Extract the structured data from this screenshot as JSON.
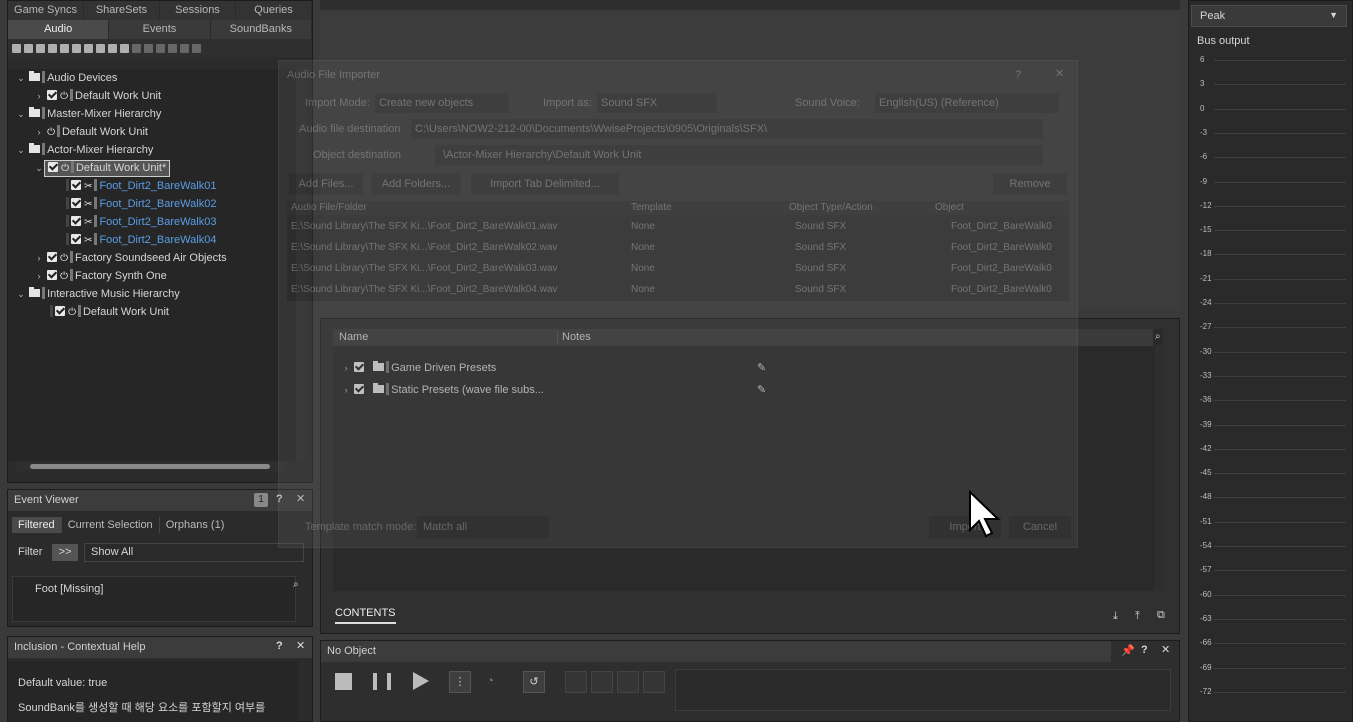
{
  "project_explorer": {
    "top_tabs": [
      "Game Syncs",
      "ShareSets",
      "Sessions",
      "Queries"
    ],
    "main_tabs": [
      "Audio",
      "Events",
      "SoundBanks"
    ],
    "tree": [
      {
        "label": "Audio Devices",
        "kind": "folder"
      },
      {
        "label": "Default Work Unit",
        "kind": "wu"
      },
      {
        "label": "Master-Mixer Hierarchy",
        "kind": "folder"
      },
      {
        "label": "Default Work Unit",
        "kind": "wu"
      },
      {
        "label": "Actor-Mixer Hierarchy",
        "kind": "folder"
      },
      {
        "label": "Default Work Unit*",
        "kind": "wu-selected"
      },
      {
        "label": "Foot_Dirt2_BareWalk01",
        "kind": "sfx"
      },
      {
        "label": "Foot_Dirt2_BareWalk02",
        "kind": "sfx"
      },
      {
        "label": "Foot_Dirt2_BareWalk03",
        "kind": "sfx"
      },
      {
        "label": "Foot_Dirt2_BareWalk04",
        "kind": "sfx"
      },
      {
        "label": "Factory Soundseed Air Objects",
        "kind": "wu"
      },
      {
        "label": "Factory Synth One",
        "kind": "wu"
      },
      {
        "label": "Interactive Music Hierarchy",
        "kind": "folder"
      },
      {
        "label": "Default Work Unit",
        "kind": "wu"
      }
    ]
  },
  "event_viewer": {
    "title": "Event Viewer",
    "badge": "1",
    "tabs": [
      "Filtered",
      "Current Selection",
      "Orphans (1)"
    ],
    "filter_label": "Filter",
    "filter_btn": ">>",
    "filter_value": "Show All",
    "result": "Foot [Missing]"
  },
  "inclusion_help": {
    "title": "Inclusion - Contextual Help",
    "line1": "Default value: true",
    "line2": "SoundBank를 생성할 때 해당 요소를 포함할지 여부를"
  },
  "importer": {
    "title": "Audio File Importer",
    "import_mode_label": "Import Mode:",
    "import_mode_value": "Create new objects",
    "import_as_label": "Import as:",
    "import_as_value": "Sound SFX",
    "voice_label": "Sound Voice:",
    "voice_value": "English(US) (Reference)",
    "dest_label": "Audio file destination",
    "dest_value": "C:\\Users\\NOW2-212-00\\Documents\\WwiseProjects\\0905\\Originals\\SFX\\",
    "obj_dest_label": "Object destination",
    "obj_dest_value": "\\Actor-Mixer Hierarchy\\Default Work Unit",
    "add_files": "Add Files...",
    "add_folders": "Add Folders...",
    "import_tab": "Import Tab Delimited...",
    "remove": "Remove",
    "columns": [
      "Audio File/Folder",
      "Template",
      "Object Type/Action",
      "Object"
    ],
    "rows": [
      {
        "file": "E:\\Sound Library\\The SFX Ki...\\Foot_Dirt2_BareWalk01.wav",
        "template": "None",
        "type": "Sound SFX",
        "object": "Foot_Dirt2_BareWalk0"
      },
      {
        "file": "E:\\Sound Library\\The SFX Ki...\\Foot_Dirt2_BareWalk02.wav",
        "template": "None",
        "type": "Sound SFX",
        "object": "Foot_Dirt2_BareWalk0"
      },
      {
        "file": "E:\\Sound Library\\The SFX Ki...\\Foot_Dirt2_BareWalk03.wav",
        "template": "None",
        "type": "Sound SFX",
        "object": "Foot_Dirt2_BareWalk0"
      },
      {
        "file": "E:\\Sound Library\\The SFX Ki...\\Foot_Dirt2_BareWalk04.wav",
        "template": "None",
        "type": "Sound SFX",
        "object": "Foot_Dirt2_BareWalk0"
      }
    ],
    "template_mode_label": "Template match mode:",
    "template_mode_value": "Match all",
    "import_btn": "Import",
    "cancel_btn": "Cancel"
  },
  "contents": {
    "col_name": "Name",
    "col_notes": "Notes",
    "items": [
      "Game Driven Presets",
      "Static Presets (wave file subs..."
    ],
    "tab": "CONTENTS"
  },
  "transport": {
    "title": "No Object"
  },
  "meter": {
    "mode": "Peak",
    "label": "Bus output",
    "ticks": [
      "6",
      "3",
      "0",
      "-3",
      "-6",
      "-9",
      "-12",
      "-15",
      "-18",
      "-21",
      "-24",
      "-27",
      "-30",
      "-33",
      "-36",
      "-39",
      "-42",
      "-45",
      "-48",
      "-51",
      "-54",
      "-57",
      "-60",
      "-63",
      "-66",
      "-69",
      "-72"
    ]
  }
}
